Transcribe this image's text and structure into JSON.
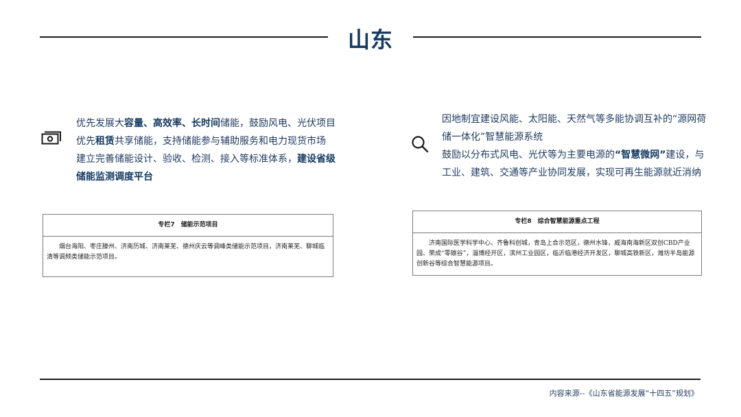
{
  "page": {
    "title": "山东"
  },
  "left": {
    "icon": "cash-icon",
    "lines": [
      [
        {
          "t": "优先发展大",
          "b": false
        },
        {
          "t": "容量、高效率、长时间",
          "b": true
        },
        {
          "t": "储能，鼓励风电、光伏项目",
          "b": false
        }
      ],
      [
        {
          "t": "优先",
          "b": false
        },
        {
          "t": "租赁",
          "b": true
        },
        {
          "t": "共享储能，支持储能参与辅助服务和电力现货市场",
          "b": false
        }
      ],
      [
        {
          "t": "建立完善储能设计、验收、检测、接入等标准体系，",
          "b": false
        },
        {
          "t": "建设省级",
          "b": true
        }
      ],
      [
        {
          "t": "储能监测调度平台",
          "b": true
        }
      ]
    ],
    "box": {
      "header": "专栏7　储能示范项目",
      "body": "烟台海阳、枣庄滕州、济南历城、济南莱芜、德州庆云等调峰类储能示范项目，济南莱芜、聊城临清等调频类储能示范项目。"
    }
  },
  "right": {
    "icon": "search-icon",
    "lines": [
      [
        {
          "t": "因地制宜建设风能、太阳能、天然气等多能协调互补的“源网荷",
          "b": false
        }
      ],
      [
        {
          "t": "储一体化”智慧能源系统",
          "b": false
        }
      ],
      [
        {
          "t": "鼓励以分布式风电、光伏等为主要电源的",
          "b": false
        },
        {
          "t": "“智慧微网”",
          "b": true
        },
        {
          "t": "建设，与",
          "b": false
        }
      ],
      [
        {
          "t": "工业、建筑、交通等产业协同发展，实现可再生能源就近消纳",
          "b": false
        }
      ]
    ],
    "box": {
      "header": "专栏8　综合智慧能源重点工程",
      "body": "济南国际医学科学中心、齐鲁科创城，青岛上合示范区，德州水锋，威海南海新区双创CBD产业园、荣成“零碳谷”，淄博经开区，滨州工业园区，临沂临港经济开发区，聊城高铁新区，潍坊半岛能源创新谷等综合智慧能源项目。"
    }
  },
  "footer": {
    "source": "内容来源--《山东省能源发展“十四五”规划》"
  }
}
